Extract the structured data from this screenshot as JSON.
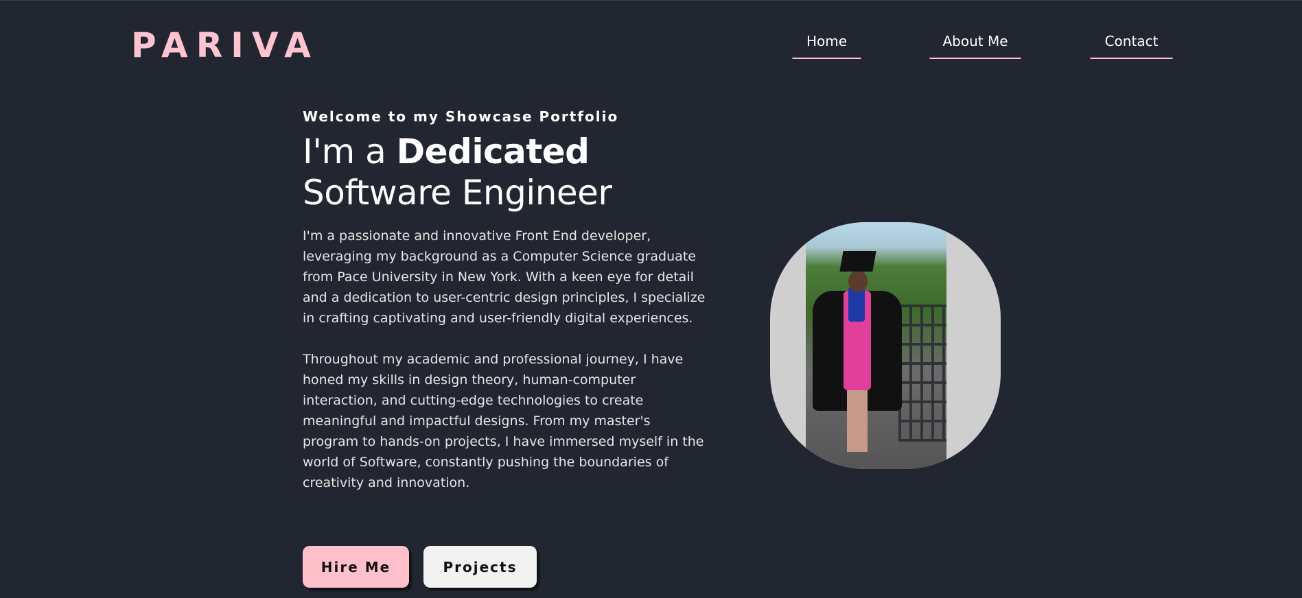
{
  "header": {
    "logo": "PARIVA",
    "nav": {
      "home": "Home",
      "about": "About Me",
      "contact": "Contact"
    }
  },
  "hero": {
    "welcome": "Welcome to my Showcase Portfolio",
    "headline_prefix": "I'm a ",
    "headline_bold": "Dedicated",
    "headline_line2": "Software Engineer",
    "paragraph1": "I'm a passionate and innovative Front End developer, leveraging my background as a Computer Science graduate from Pace University in New York. With a keen eye for detail and a dedication to user-centric design principles, I specialize in crafting captivating and user-friendly digital experiences.",
    "paragraph2": "Throughout my academic and professional journey, I have honed my skills in design theory, human-computer interaction, and cutting-edge technologies to create meaningful and impactful designs. From my master's program to hands-on projects, I have immersed myself in the world of Software, constantly pushing the boundaries of creativity and innovation.",
    "buttons": {
      "hire": "Hire Me",
      "projects": "Projects"
    }
  },
  "colors": {
    "background": "#222630",
    "accent_pink": "#ffc4d0",
    "button_light": "#f2f2f2"
  }
}
